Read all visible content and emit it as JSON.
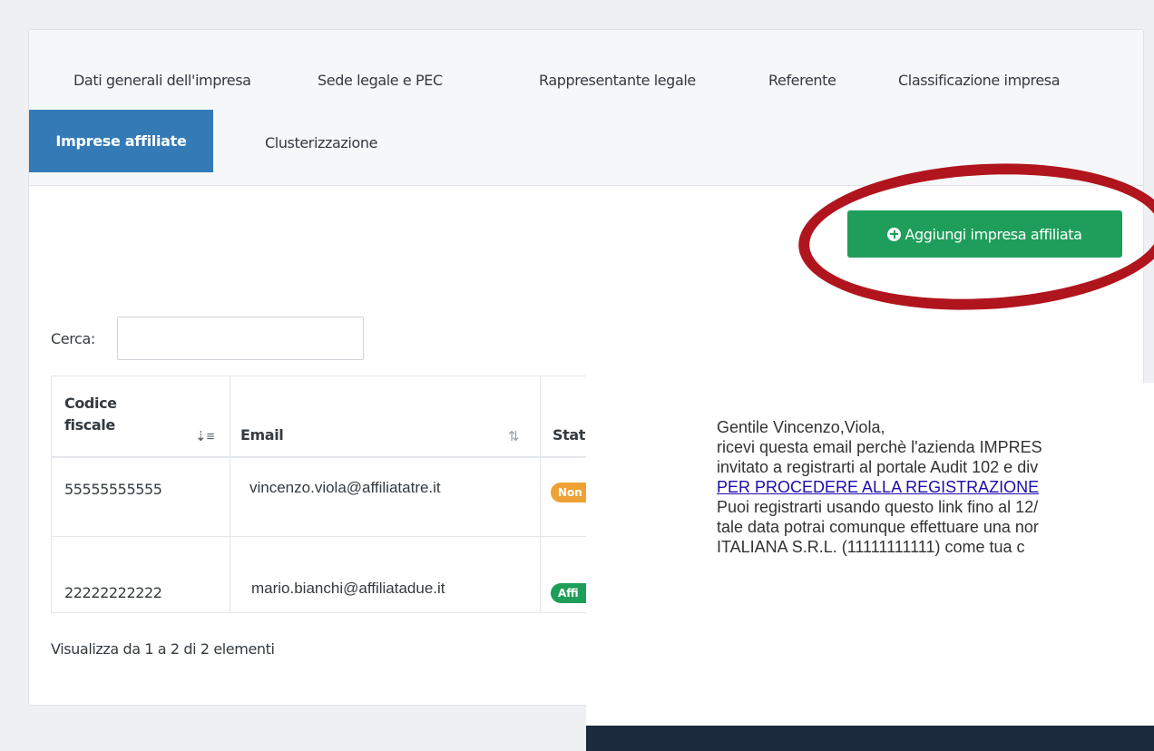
{
  "tabs": {
    "items": [
      {
        "label": "Dati generali dell'impresa"
      },
      {
        "label": "Sede legale e PEC"
      },
      {
        "label": "Rappresentante legale"
      },
      {
        "label": "Referente"
      },
      {
        "label": "Classificazione impresa"
      },
      {
        "label": "Imprese affiliate",
        "active": true
      },
      {
        "label": "Clusterizzazione"
      }
    ]
  },
  "actions": {
    "add_affiliate_label": "Aggiungi impresa affiliata",
    "add_icon": "plus-circle-icon"
  },
  "search": {
    "label": "Cerca:",
    "value": ""
  },
  "table": {
    "columns": [
      {
        "label": "Codice\nfiscale",
        "sort": "sort-desc-icon"
      },
      {
        "label": "Email",
        "sort": "sort-both-icon"
      },
      {
        "label": "Stat"
      }
    ],
    "rows": [
      {
        "codice_fiscale": "55555555555",
        "email": "vincenzo.viola@affiliatatre.it",
        "stato": "Non",
        "stato_color": "#eea236"
      },
      {
        "codice_fiscale": "22222222222",
        "email": "mario.bianchi@affiliatadue.it",
        "stato": "Affi",
        "stato_color": "#1e9e5a"
      }
    ]
  },
  "footer": {
    "info": "Visualizza da 1 a 2 di 2 elementi"
  },
  "email_preview": {
    "lines": [
      "Gentile Vincenzo,Viola,",
      "ricevi questa email perchè l'azienda IMPRES",
      "invitato a registrarti al portale Audit 102 e div",
      "PER PROCEDERE ALLA REGISTRAZIONE",
      "Puoi registrarti usando questo link fino al 12/",
      "tale data potrai comunque effettuare una nor",
      "ITALIANA S.R.L. (11111111111) come tua c"
    ]
  },
  "colors": {
    "primary": "#337ab7",
    "success": "#1e9e5a",
    "warning": "#eea236",
    "highlight_ring": "#b0151d"
  }
}
